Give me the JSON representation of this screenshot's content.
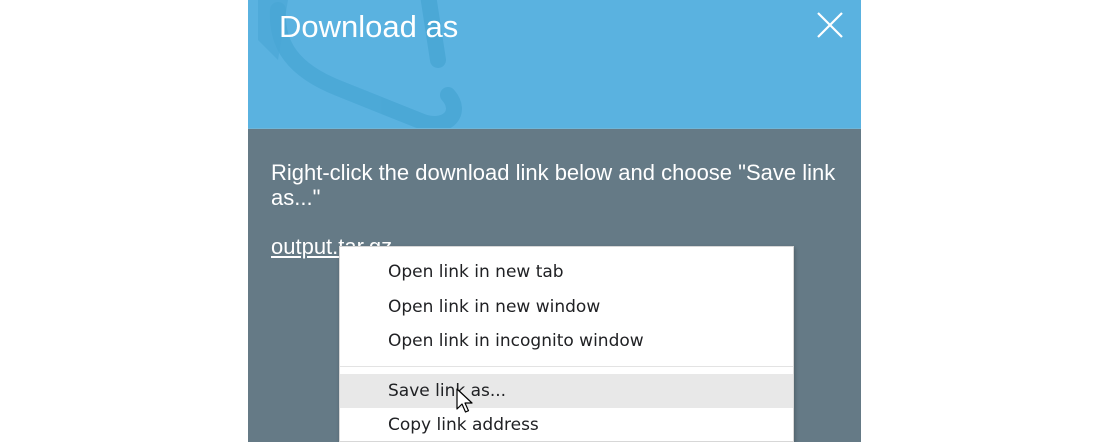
{
  "dialog": {
    "title": "Download as",
    "instruction": "Right-click the download link below and choose \"Save link as...\"",
    "link_text": "output.tar.gz",
    "close_icon": "close-icon",
    "colors": {
      "header": "#5ab2e0",
      "body": "#657a86",
      "text": "#ffffff"
    }
  },
  "context_menu": {
    "items": [
      {
        "label": "Open link in new tab"
      },
      {
        "label": "Open link in new window"
      },
      {
        "label": "Open link in incognito window"
      }
    ],
    "items_group2": [
      {
        "label": "Save link as...",
        "hovered": true
      },
      {
        "label": "Copy link address"
      }
    ]
  },
  "cursor": {
    "icon": "mouse-pointer-icon"
  }
}
